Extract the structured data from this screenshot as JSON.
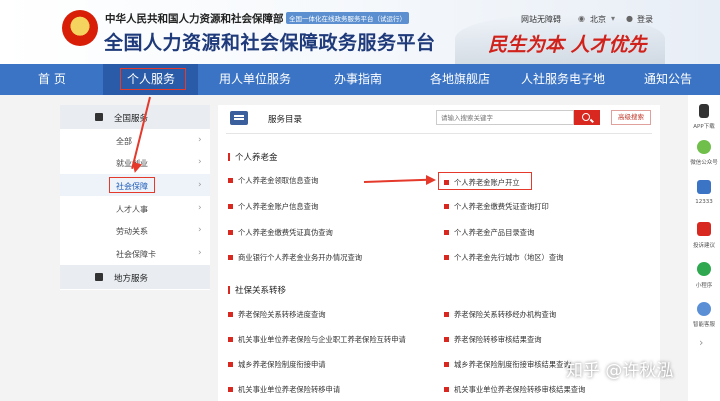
{
  "header": {
    "org_name": "中华人民共和国人力资源和社会保障部",
    "badge": "全国一体化在线政务服务平台（试运行）",
    "site_title": "全国人力资源和社会保障政务服务平台",
    "slogan": "民生为本 人才优先",
    "links": {
      "accessibility": "网站无障碍",
      "location": "北京",
      "login": "登录"
    }
  },
  "nav": {
    "items": [
      "首 页",
      "个人服务",
      "用人单位服务",
      "办事指南",
      "各地旗舰店",
      "人社服务电子地",
      "通知公告"
    ],
    "active": "个人服务"
  },
  "sidebar": {
    "section1": "全国服务",
    "items": [
      "全部",
      "就业创业",
      "社会保障",
      "人才人事",
      "劳动关系",
      "社会保障卡"
    ],
    "active": "社会保障",
    "section2": "地方服务"
  },
  "main": {
    "title": "服务目录",
    "search_placeholder": "请输入搜索关键字",
    "advanced_search": "高级搜索",
    "sections": [
      {
        "title": "个人养老金",
        "links_left": [
          "个人养老金领取信息查询",
          "个人养老金账户信息查询",
          "个人养老金缴费凭证真伪查询",
          "商业银行个人养老金业务开办情况查询"
        ],
        "links_right": [
          "个人养老金账户开立",
          "个人养老金缴费凭证查询打印",
          "个人养老金产品目录查询",
          "个人养老金先行城市（地区）查询"
        ]
      },
      {
        "title": "社保关系转移",
        "links_left": [
          "养老保险关系转移进度查询",
          "机关事业单位养老保险与企业职工养老保险互转申请",
          "城乡养老保险制度衔接申请",
          "机关事业单位养老保险转移申请"
        ],
        "links_right": [
          "养老保险关系转移经办机构查询",
          "养老保险转移审核结果查询",
          "城乡养老保险制度衔接审核结果查询",
          "机关事业单位养老保险转移审核结果查询"
        ]
      }
    ]
  },
  "toolbar": [
    "APP下载",
    "微信公众号",
    "12333",
    "投诉建议",
    "小程序",
    "智能客服"
  ],
  "watermark": "知乎 @许秋泓"
}
